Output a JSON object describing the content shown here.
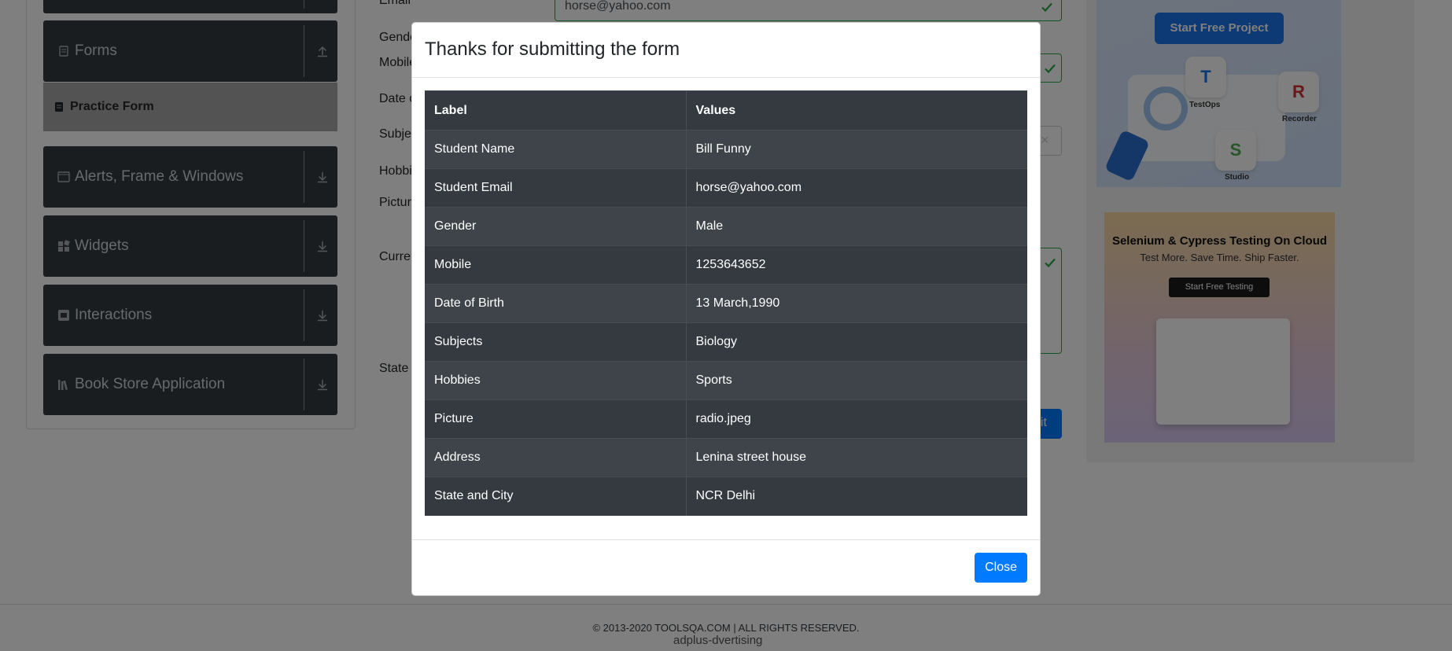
{
  "sidebar": {
    "groups": [
      {
        "label": "Forms",
        "icon": "document-icon",
        "arrow": "upload-arrow-icon"
      },
      {
        "label": "Alerts, Frame & Windows",
        "icon": "window-icon",
        "arrow": "download-arrow-icon"
      },
      {
        "label": "Widgets",
        "icon": "widgets-icon",
        "arrow": "download-arrow-icon"
      },
      {
        "label": "Interactions",
        "icon": "interactions-icon",
        "arrow": "download-arrow-icon"
      },
      {
        "label": "Book Store Application",
        "icon": "books-icon",
        "arrow": "download-arrow-icon"
      }
    ],
    "active_item": "Practice Form"
  },
  "form": {
    "labels": [
      "Email",
      "Gende",
      "Mobile",
      "Date o",
      "Subje",
      "Hobbi",
      "Picture",
      "Curren",
      "State"
    ],
    "email_value": "horse@yahoo.com",
    "submit_label": "nit",
    "clear_glyph": "×"
  },
  "ads": {
    "ad1": {
      "button": "Start Free Project",
      "tiles": [
        "TestOps",
        "Recorder",
        "Studio"
      ]
    },
    "ad2": {
      "title": "Selenium & Cypress Testing On Cloud",
      "subtitle": "Test More. Save Time. Ship Faster.",
      "button": "Start Free Testing"
    }
  },
  "footer": {
    "copyright": "© 2013-2020 TOOLSQA.COM | ALL RIGHTS RESERVED.",
    "ad_alt": "adplus-dvertising"
  },
  "modal": {
    "title": "Thanks for submitting the form",
    "headers": {
      "label": "Label",
      "values": "Values"
    },
    "rows": [
      {
        "label": "Student Name",
        "value": "Bill Funny"
      },
      {
        "label": "Student Email",
        "value": "horse@yahoo.com"
      },
      {
        "label": "Gender",
        "value": "Male"
      },
      {
        "label": "Mobile",
        "value": "1253643652"
      },
      {
        "label": "Date of Birth",
        "value": "13 March,1990"
      },
      {
        "label": "Subjects",
        "value": "Biology"
      },
      {
        "label": "Hobbies",
        "value": "Sports"
      },
      {
        "label": "Picture",
        "value": "radio.jpeg"
      },
      {
        "label": "Address",
        "value": "Lenina street house"
      },
      {
        "label": "State and City",
        "value": "NCR Delhi"
      }
    ],
    "close_label": "Close"
  },
  "colors": {
    "primary": "#007bff",
    "table_dark": "#343a40",
    "sidebar_dark": "#353a40",
    "valid_green": "#28a745"
  }
}
